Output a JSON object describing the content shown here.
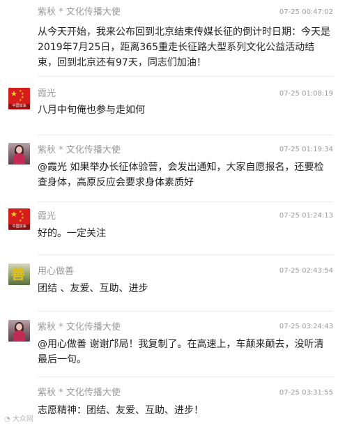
{
  "comments": [
    {
      "name": "紫秋 * 文化传播大使",
      "time": "07-25 00:47:02",
      "text": "从今天开始，我来公布回到北京结束传媒长征的倒计时日期：今天是2019年7月25日，距离365重走长征路大型系列文化公益活动结束，回到北京还有97天，同志们加油！",
      "avatar": "none"
    },
    {
      "name": "霞光",
      "time": "07-25 01:08:19",
      "text": "八月中旬俺也参与走如何",
      "avatar": "flag-avatar",
      "avatar_caption": "中国加油"
    },
    {
      "name": "紫秋 * 文化传播大使",
      "time": "07-25 01:19:34",
      "text": "@霞光 如果举办长征体验营，会发出通知，大家自愿报名，还要检查身体，高原反应会要求身体素质好",
      "avatar": "person-avatar"
    },
    {
      "name": "霞光",
      "time": "07-25 01:24:13",
      "text": "好的。一定关注",
      "avatar": "flag-avatar",
      "avatar_caption": "中国加油"
    },
    {
      "name": "用心做善",
      "time": "07-25 02:43:54",
      "text": "团结 、友爱、互助、进步",
      "avatar": "art-avatar",
      "avatar_glyph": "善"
    },
    {
      "name": "紫秋 * 文化传播大使",
      "time": "07-25 03:24:43",
      "text": "@用心做善 谢谢邝局！我复制了。在高速上，车颠来颠去，没听清最后一句。",
      "avatar": "person-avatar"
    },
    {
      "name": "紫秋 * 文化传播大使",
      "time": "07-25 03:31:55",
      "text": "志愿精神：团结、友爱、互助、进步！",
      "avatar": "none"
    }
  ],
  "watermark": "大众网"
}
